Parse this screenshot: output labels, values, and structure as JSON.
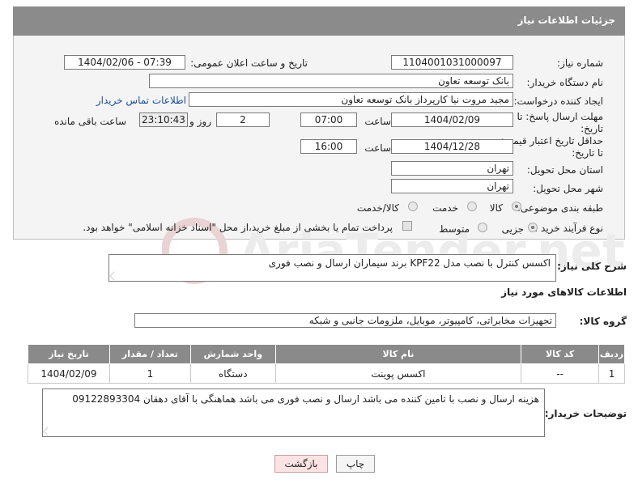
{
  "header": {
    "title": "جزئیات اطلاعات نیاز"
  },
  "need": {
    "number_label": "شماره نیاز:",
    "number": "1104001031000097",
    "announce_label": "تاریخ و ساعت اعلان عمومی:",
    "announce_value": "1404/02/06 - 07:39",
    "buyer_org_label": "نام دستگاه خریدار:",
    "buyer_org": "بانک توسعه تعاون",
    "creator_label": "ایجاد کننده درخواست:",
    "creator": "مجید مروت نیا کارپرداز بانک توسعه تعاون",
    "contact_link": "اطلاعات تماس خریدار",
    "reply_deadline_label": "مهلت ارسال پاسخ: تا تاریخ:",
    "reply_date": "1404/02/09",
    "time_label": "ساعت",
    "reply_time": "07:00",
    "days_value": "2",
    "days_label": "روز و",
    "remaining_time": "23:10:43",
    "remaining_label": "ساعت باقی مانده",
    "price_validity_label": "حداقل تاریخ اعتبار قیمت: تا تاریخ:",
    "price_date": "1404/12/28",
    "price_time": "16:00",
    "province_label": "استان محل تحویل:",
    "province": "تهران",
    "city_label": "شهر محل تحویل:",
    "city": "تهران",
    "category_label": "طبقه بندی موضوعی:",
    "category_options": [
      "کالا",
      "خدمت",
      "کالا/خدمت"
    ],
    "process_label": "نوع فرآیند خرید :",
    "process_options": [
      "جزیی",
      "متوسط"
    ],
    "payment_note": "پرداخت تمام یا بخشی از مبلغ خرید،از محل \"اسناد خزانه اسلامی\" خواهد بود."
  },
  "description": {
    "label": "شرح کلی نیاز:",
    "value": "اکسس کنترل با نصب مدل KPF22 برند سیماران ارسال و نصب فوری"
  },
  "goods": {
    "section_title": "اطلاعات کالاهای مورد نیاز",
    "group_label": "گروه کالا:",
    "group_value": "تجهیزات مخابراتی، کامپیوتر، موبایل، ملزومات جانبی و شبکه",
    "columns": [
      "ردیف",
      "کد کالا",
      "نام کالا",
      "واحد شمارش",
      "تعداد / مقدار",
      "تاریخ نیاز"
    ],
    "rows": [
      [
        "1",
        "--",
        "اکسس پوینت",
        "دستگاه",
        "1",
        "1404/02/09"
      ]
    ]
  },
  "buyer_notes": {
    "label": "توضیحات خریدار:",
    "value": "هزینه ارسال و نصب با تامین کننده می باشد ارسال و نصب فوری می باشد هماهنگی با آقای دهقان 09122893304"
  },
  "buttons": {
    "print": "چاپ",
    "back": "بازگشت"
  },
  "watermark": {
    "text": "AriaTender.net"
  },
  "colors": {
    "header_bg": "#8b8b8b",
    "link": "#1a4f9c",
    "back_button_bg": "#fbe3e3"
  }
}
